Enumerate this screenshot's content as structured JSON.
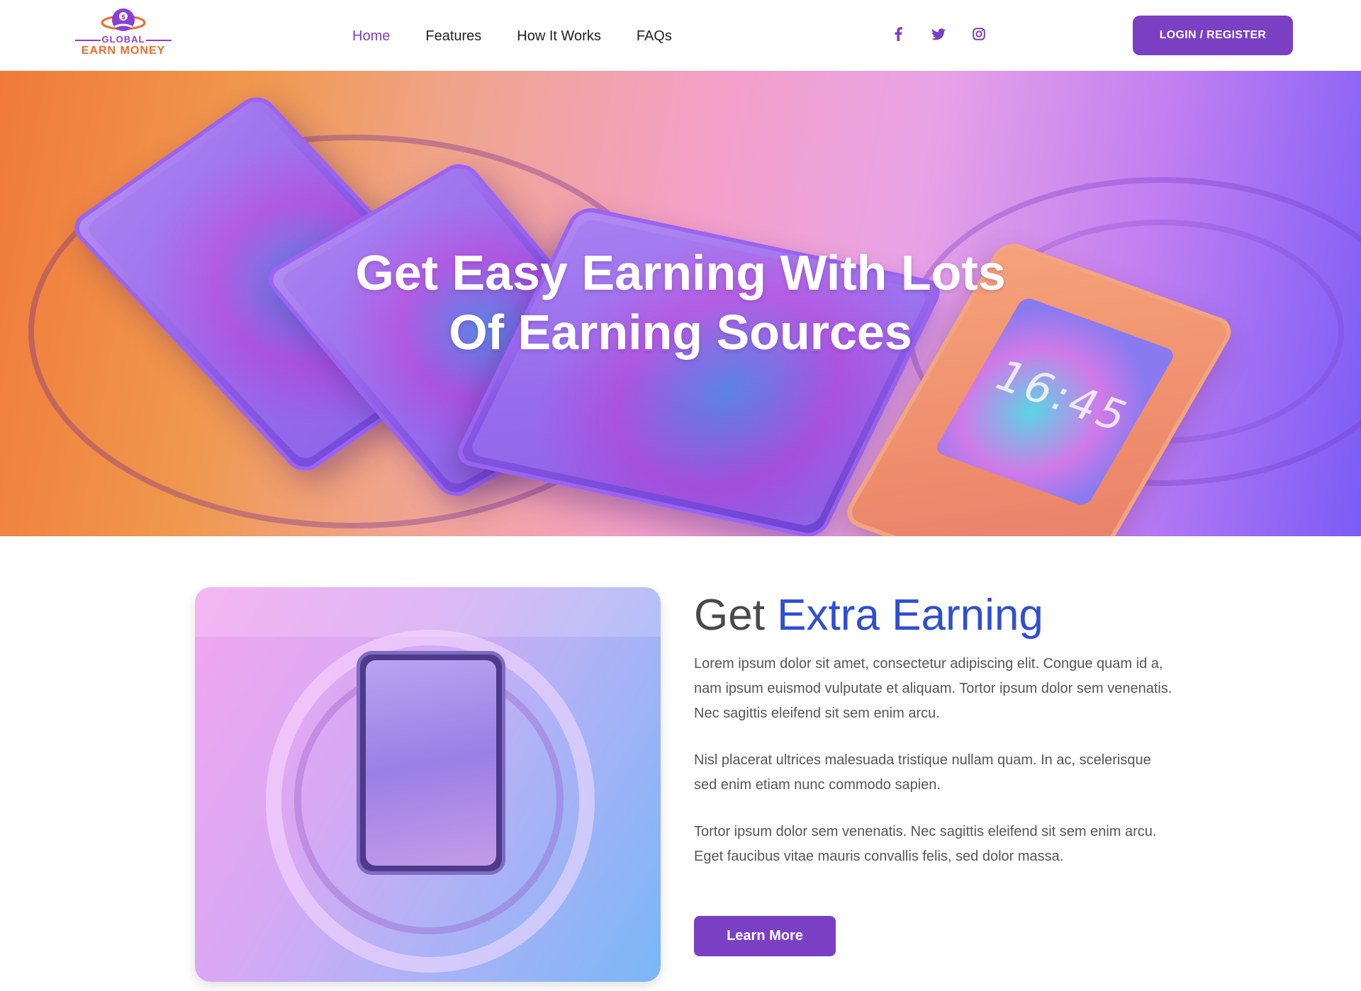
{
  "header": {
    "logo": {
      "top": "GLOBAL",
      "bottom": "EARN MONEY"
    },
    "nav": [
      {
        "label": "Home",
        "active": true
      },
      {
        "label": "Features",
        "active": false
      },
      {
        "label": "How It Works",
        "active": false
      },
      {
        "label": "FAQs",
        "active": false
      }
    ],
    "social": [
      "facebook-icon",
      "twitter-icon",
      "instagram-icon"
    ],
    "login_label": "LOGIN / REGISTER"
  },
  "hero": {
    "title_line1": "Get Easy Earning With Lots",
    "title_line2": "Of Earning Sources",
    "clock_time": "16:45"
  },
  "feature": {
    "title_plain": "Get ",
    "title_accent": "Extra Earning",
    "paragraphs": [
      "Lorem ipsum dolor sit amet, consectetur adipiscing elit. Congue quam id a, nam ipsum euismod vulputate et aliquam. Tortor ipsum dolor sem venenatis. Nec sagittis eleifend sit sem enim arcu.",
      "Nisl placerat ultrices malesuada tristique nullam quam. In ac, scelerisque sed enim etiam nunc commodo sapien.",
      "Tortor ipsum dolor sem venenatis. Nec sagittis eleifend sit sem enim arcu. Eget faucibus vitae mauris convallis felis, sed dolor massa."
    ],
    "button_label": "Learn More"
  },
  "colors": {
    "brand": "#7b3fc4",
    "accent": "#2f4fd0",
    "logo_orange": "#ef6a2d"
  }
}
